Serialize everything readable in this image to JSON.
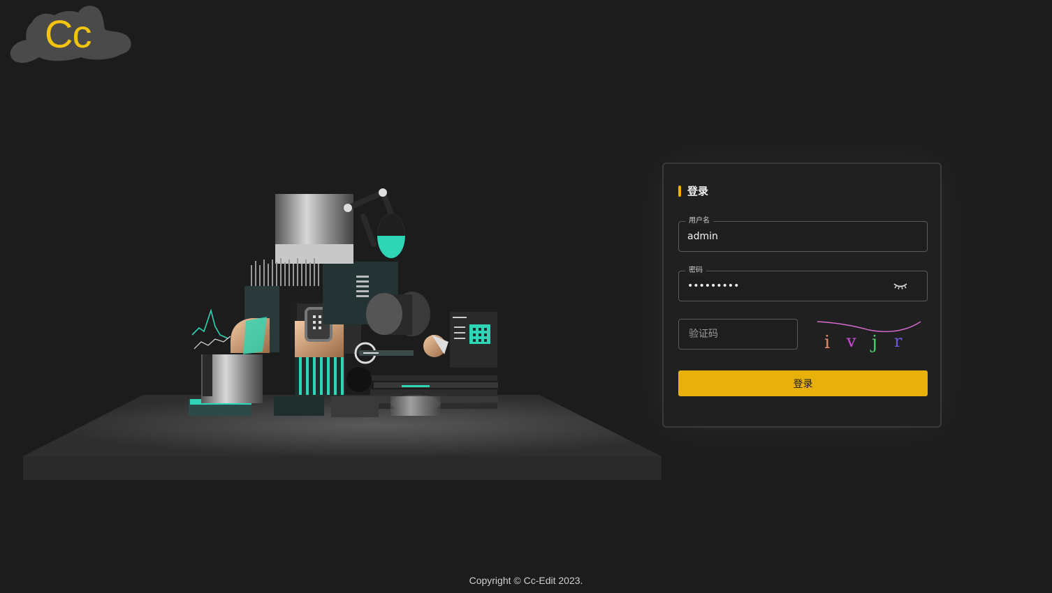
{
  "logo": {
    "text": "Cc",
    "color": "#f2c40f"
  },
  "login": {
    "title": "登录",
    "username": {
      "label": "用户名",
      "value": "admin"
    },
    "password": {
      "label": "密码",
      "value": "•••••••••",
      "toggle_icon": "eye-closed-icon"
    },
    "captcha": {
      "placeholder": "验证码",
      "code": "ivjr"
    },
    "submit_label": "登录",
    "accent_color": "#e8b00b"
  },
  "footer": {
    "copyright": "Copyright © Cc-Edit 2023."
  }
}
